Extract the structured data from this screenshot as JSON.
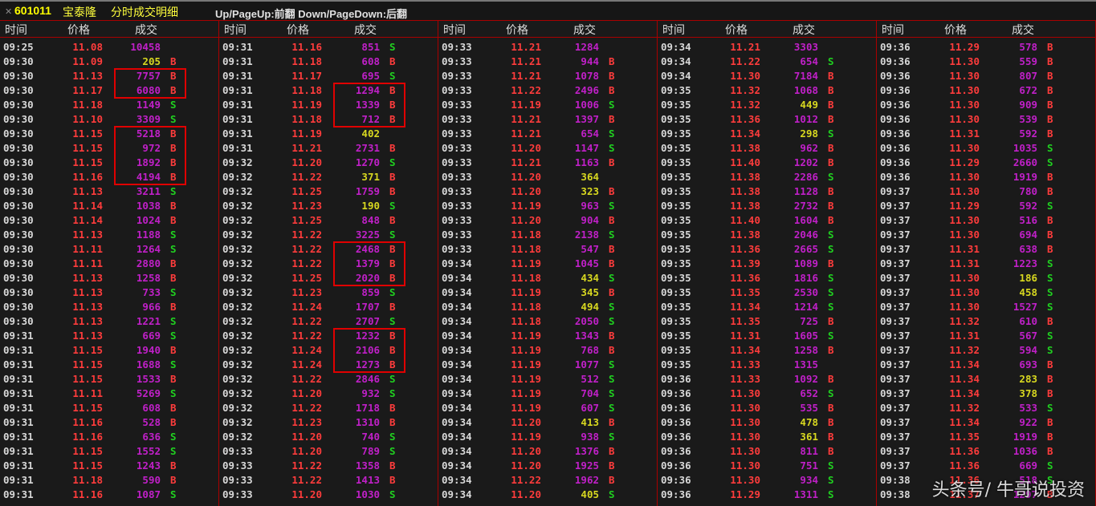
{
  "titlebar": {
    "close_icon": "close-icon",
    "stock_code": "601011",
    "stock_name": "宝泰隆",
    "subtitle": "分时成交明细",
    "hint": "Up/PageUp:前翻 Down/PageDown:后翻"
  },
  "headers": {
    "time": "时间",
    "price": "价格",
    "volume": "成交"
  },
  "colors": {
    "time": "#d8d8d8",
    "price_up": "#ff3c3c",
    "volume_large": "#c020c8",
    "volume_small": "#d8d820",
    "buy": "#ff3c3c",
    "sell": "#20d020",
    "highlight_box": "#e00000"
  },
  "columns": [
    {
      "rows": [
        [
          "09:25",
          "11.08",
          "10458",
          ""
        ],
        [
          "09:30",
          "11.09",
          "205",
          "B"
        ],
        [
          "09:30",
          "11.13",
          "7757",
          "B"
        ],
        [
          "09:30",
          "11.17",
          "6080",
          "B"
        ],
        [
          "09:30",
          "11.18",
          "1149",
          "S"
        ],
        [
          "09:30",
          "11.10",
          "3309",
          "S"
        ],
        [
          "09:30",
          "11.15",
          "5218",
          "B"
        ],
        [
          "09:30",
          "11.15",
          "972",
          "B"
        ],
        [
          "09:30",
          "11.15",
          "1892",
          "B"
        ],
        [
          "09:30",
          "11.16",
          "4194",
          "B"
        ],
        [
          "09:30",
          "11.13",
          "3211",
          "S"
        ],
        [
          "09:30",
          "11.14",
          "1038",
          "B"
        ],
        [
          "09:30",
          "11.14",
          "1024",
          "B"
        ],
        [
          "09:30",
          "11.13",
          "1188",
          "S"
        ],
        [
          "09:30",
          "11.11",
          "1264",
          "S"
        ],
        [
          "09:30",
          "11.11",
          "2880",
          "B"
        ],
        [
          "09:30",
          "11.13",
          "1258",
          "B"
        ],
        [
          "09:30",
          "11.13",
          "733",
          "S"
        ],
        [
          "09:30",
          "11.13",
          "966",
          "B"
        ],
        [
          "09:30",
          "11.13",
          "1221",
          "S"
        ],
        [
          "09:31",
          "11.13",
          "669",
          "S"
        ],
        [
          "09:31",
          "11.15",
          "1940",
          "B"
        ],
        [
          "09:31",
          "11.15",
          "1688",
          "S"
        ],
        [
          "09:31",
          "11.15",
          "1533",
          "B"
        ],
        [
          "09:31",
          "11.11",
          "5269",
          "S"
        ],
        [
          "09:31",
          "11.15",
          "608",
          "B"
        ],
        [
          "09:31",
          "11.16",
          "528",
          "B"
        ],
        [
          "09:31",
          "11.16",
          "636",
          "S"
        ],
        [
          "09:31",
          "11.15",
          "1552",
          "S"
        ],
        [
          "09:31",
          "11.15",
          "1243",
          "B"
        ],
        [
          "09:31",
          "11.18",
          "590",
          "B"
        ],
        [
          "09:31",
          "11.16",
          "1087",
          "S"
        ]
      ],
      "highlights": [
        [
          2,
          3
        ],
        [
          6,
          9
        ]
      ]
    },
    {
      "rows": [
        [
          "09:31",
          "11.16",
          "851",
          "S"
        ],
        [
          "09:31",
          "11.18",
          "608",
          "B"
        ],
        [
          "09:31",
          "11.17",
          "695",
          "S"
        ],
        [
          "09:31",
          "11.18",
          "1294",
          "B"
        ],
        [
          "09:31",
          "11.19",
          "1339",
          "B"
        ],
        [
          "09:31",
          "11.18",
          "712",
          "B"
        ],
        [
          "09:31",
          "11.19",
          "402",
          ""
        ],
        [
          "09:31",
          "11.21",
          "2731",
          "B"
        ],
        [
          "09:32",
          "11.20",
          "1270",
          "S"
        ],
        [
          "09:32",
          "11.22",
          "371",
          "B"
        ],
        [
          "09:32",
          "11.25",
          "1759",
          "B"
        ],
        [
          "09:32",
          "11.23",
          "190",
          "S"
        ],
        [
          "09:32",
          "11.25",
          "848",
          "B"
        ],
        [
          "09:32",
          "11.22",
          "3225",
          "S"
        ],
        [
          "09:32",
          "11.22",
          "2468",
          "B"
        ],
        [
          "09:32",
          "11.22",
          "1379",
          "B"
        ],
        [
          "09:32",
          "11.25",
          "2020",
          "B"
        ],
        [
          "09:32",
          "11.23",
          "859",
          "S"
        ],
        [
          "09:32",
          "11.24",
          "1707",
          "B"
        ],
        [
          "09:32",
          "11.22",
          "2707",
          "S"
        ],
        [
          "09:32",
          "11.22",
          "1232",
          "B"
        ],
        [
          "09:32",
          "11.24",
          "2106",
          "B"
        ],
        [
          "09:32",
          "11.24",
          "1273",
          "B"
        ],
        [
          "09:32",
          "11.22",
          "2846",
          "S"
        ],
        [
          "09:32",
          "11.20",
          "932",
          "S"
        ],
        [
          "09:32",
          "11.22",
          "1718",
          "B"
        ],
        [
          "09:32",
          "11.23",
          "1310",
          "B"
        ],
        [
          "09:32",
          "11.20",
          "740",
          "S"
        ],
        [
          "09:33",
          "11.20",
          "789",
          "S"
        ],
        [
          "09:33",
          "11.22",
          "1358",
          "B"
        ],
        [
          "09:33",
          "11.22",
          "1413",
          "B"
        ],
        [
          "09:33",
          "11.20",
          "1030",
          "S"
        ]
      ],
      "highlights": [
        [
          3,
          5
        ],
        [
          14,
          16
        ],
        [
          20,
          22
        ]
      ]
    },
    {
      "rows": [
        [
          "09:33",
          "11.21",
          "1284",
          ""
        ],
        [
          "09:33",
          "11.21",
          "944",
          "B"
        ],
        [
          "09:33",
          "11.21",
          "1078",
          "B"
        ],
        [
          "09:33",
          "11.22",
          "2496",
          "B"
        ],
        [
          "09:33",
          "11.19",
          "1006",
          "S"
        ],
        [
          "09:33",
          "11.21",
          "1397",
          "B"
        ],
        [
          "09:33",
          "11.21",
          "654",
          "S"
        ],
        [
          "09:33",
          "11.20",
          "1147",
          "S"
        ],
        [
          "09:33",
          "11.21",
          "1163",
          "B"
        ],
        [
          "09:33",
          "11.20",
          "364",
          ""
        ],
        [
          "09:33",
          "11.20",
          "323",
          "B"
        ],
        [
          "09:33",
          "11.19",
          "963",
          "S"
        ],
        [
          "09:33",
          "11.20",
          "904",
          "B"
        ],
        [
          "09:33",
          "11.18",
          "2138",
          "S"
        ],
        [
          "09:33",
          "11.18",
          "547",
          "B"
        ],
        [
          "09:34",
          "11.19",
          "1045",
          "B"
        ],
        [
          "09:34",
          "11.18",
          "434",
          "S"
        ],
        [
          "09:34",
          "11.19",
          "345",
          "B"
        ],
        [
          "09:34",
          "11.18",
          "494",
          "S"
        ],
        [
          "09:34",
          "11.18",
          "2050",
          "S"
        ],
        [
          "09:34",
          "11.19",
          "1343",
          "B"
        ],
        [
          "09:34",
          "11.19",
          "768",
          "B"
        ],
        [
          "09:34",
          "11.19",
          "1077",
          "S"
        ],
        [
          "09:34",
          "11.19",
          "512",
          "S"
        ],
        [
          "09:34",
          "11.19",
          "704",
          "S"
        ],
        [
          "09:34",
          "11.19",
          "607",
          "S"
        ],
        [
          "09:34",
          "11.20",
          "413",
          "B"
        ],
        [
          "09:34",
          "11.19",
          "938",
          "S"
        ],
        [
          "09:34",
          "11.20",
          "1376",
          "B"
        ],
        [
          "09:34",
          "11.20",
          "1925",
          "B"
        ],
        [
          "09:34",
          "11.22",
          "1962",
          "B"
        ],
        [
          "09:34",
          "11.20",
          "405",
          "S"
        ]
      ],
      "highlights": []
    },
    {
      "rows": [
        [
          "09:34",
          "11.21",
          "3303",
          ""
        ],
        [
          "09:34",
          "11.22",
          "654",
          "S"
        ],
        [
          "09:34",
          "11.30",
          "7184",
          "B"
        ],
        [
          "09:35",
          "11.32",
          "1068",
          "B"
        ],
        [
          "09:35",
          "11.32",
          "449",
          "B"
        ],
        [
          "09:35",
          "11.36",
          "1012",
          "B"
        ],
        [
          "09:35",
          "11.34",
          "298",
          "S"
        ],
        [
          "09:35",
          "11.38",
          "962",
          "B"
        ],
        [
          "09:35",
          "11.40",
          "1202",
          "B"
        ],
        [
          "09:35",
          "11.38",
          "2286",
          "S"
        ],
        [
          "09:35",
          "11.38",
          "1128",
          "B"
        ],
        [
          "09:35",
          "11.38",
          "2732",
          "B"
        ],
        [
          "09:35",
          "11.40",
          "1604",
          "B"
        ],
        [
          "09:35",
          "11.38",
          "2046",
          "S"
        ],
        [
          "09:35",
          "11.36",
          "2665",
          "S"
        ],
        [
          "09:35",
          "11.39",
          "1089",
          "B"
        ],
        [
          "09:35",
          "11.36",
          "1816",
          "S"
        ],
        [
          "09:35",
          "11.35",
          "2530",
          "S"
        ],
        [
          "09:35",
          "11.34",
          "1214",
          "S"
        ],
        [
          "09:35",
          "11.35",
          "725",
          "B"
        ],
        [
          "09:35",
          "11.31",
          "1605",
          "S"
        ],
        [
          "09:35",
          "11.34",
          "1258",
          "B"
        ],
        [
          "09:35",
          "11.33",
          "1315",
          ""
        ],
        [
          "09:36",
          "11.33",
          "1092",
          "B"
        ],
        [
          "09:36",
          "11.30",
          "652",
          "S"
        ],
        [
          "09:36",
          "11.30",
          "535",
          "B"
        ],
        [
          "09:36",
          "11.30",
          "478",
          "B"
        ],
        [
          "09:36",
          "11.30",
          "361",
          "B"
        ],
        [
          "09:36",
          "11.30",
          "811",
          "B"
        ],
        [
          "09:36",
          "11.30",
          "751",
          "S"
        ],
        [
          "09:36",
          "11.30",
          "934",
          "S"
        ],
        [
          "09:36",
          "11.29",
          "1311",
          "S"
        ]
      ],
      "highlights": []
    },
    {
      "rows": [
        [
          "09:36",
          "11.29",
          "578",
          "B"
        ],
        [
          "09:36",
          "11.30",
          "559",
          "B"
        ],
        [
          "09:36",
          "11.30",
          "807",
          "B"
        ],
        [
          "09:36",
          "11.30",
          "672",
          "B"
        ],
        [
          "09:36",
          "11.30",
          "909",
          "B"
        ],
        [
          "09:36",
          "11.30",
          "539",
          "B"
        ],
        [
          "09:36",
          "11.31",
          "592",
          "B"
        ],
        [
          "09:36",
          "11.30",
          "1035",
          "S"
        ],
        [
          "09:36",
          "11.29",
          "2660",
          "S"
        ],
        [
          "09:36",
          "11.30",
          "1919",
          "B"
        ],
        [
          "09:37",
          "11.30",
          "780",
          "B"
        ],
        [
          "09:37",
          "11.29",
          "592",
          "S"
        ],
        [
          "09:37",
          "11.30",
          "516",
          "B"
        ],
        [
          "09:37",
          "11.30",
          "694",
          "B"
        ],
        [
          "09:37",
          "11.31",
          "638",
          "B"
        ],
        [
          "09:37",
          "11.31",
          "1223",
          "S"
        ],
        [
          "09:37",
          "11.30",
          "186",
          "S"
        ],
        [
          "09:37",
          "11.30",
          "458",
          "S"
        ],
        [
          "09:37",
          "11.30",
          "1527",
          "S"
        ],
        [
          "09:37",
          "11.32",
          "610",
          "B"
        ],
        [
          "09:37",
          "11.31",
          "567",
          "S"
        ],
        [
          "09:37",
          "11.32",
          "594",
          "S"
        ],
        [
          "09:37",
          "11.34",
          "693",
          "B"
        ],
        [
          "09:37",
          "11.34",
          "283",
          "B"
        ],
        [
          "09:37",
          "11.34",
          "378",
          "B"
        ],
        [
          "09:37",
          "11.32",
          "533",
          "S"
        ],
        [
          "09:37",
          "11.34",
          "922",
          "B"
        ],
        [
          "09:37",
          "11.35",
          "1919",
          "B"
        ],
        [
          "09:37",
          "11.36",
          "1036",
          "B"
        ],
        [
          "09:37",
          "11.36",
          "669",
          "S"
        ],
        [
          "09:38",
          "11.36",
          "518",
          "S"
        ],
        [
          "09:38",
          "11.37",
          "1297",
          "B"
        ]
      ],
      "highlights": []
    }
  ],
  "watermark": "头条号/ 牛哥说投资"
}
